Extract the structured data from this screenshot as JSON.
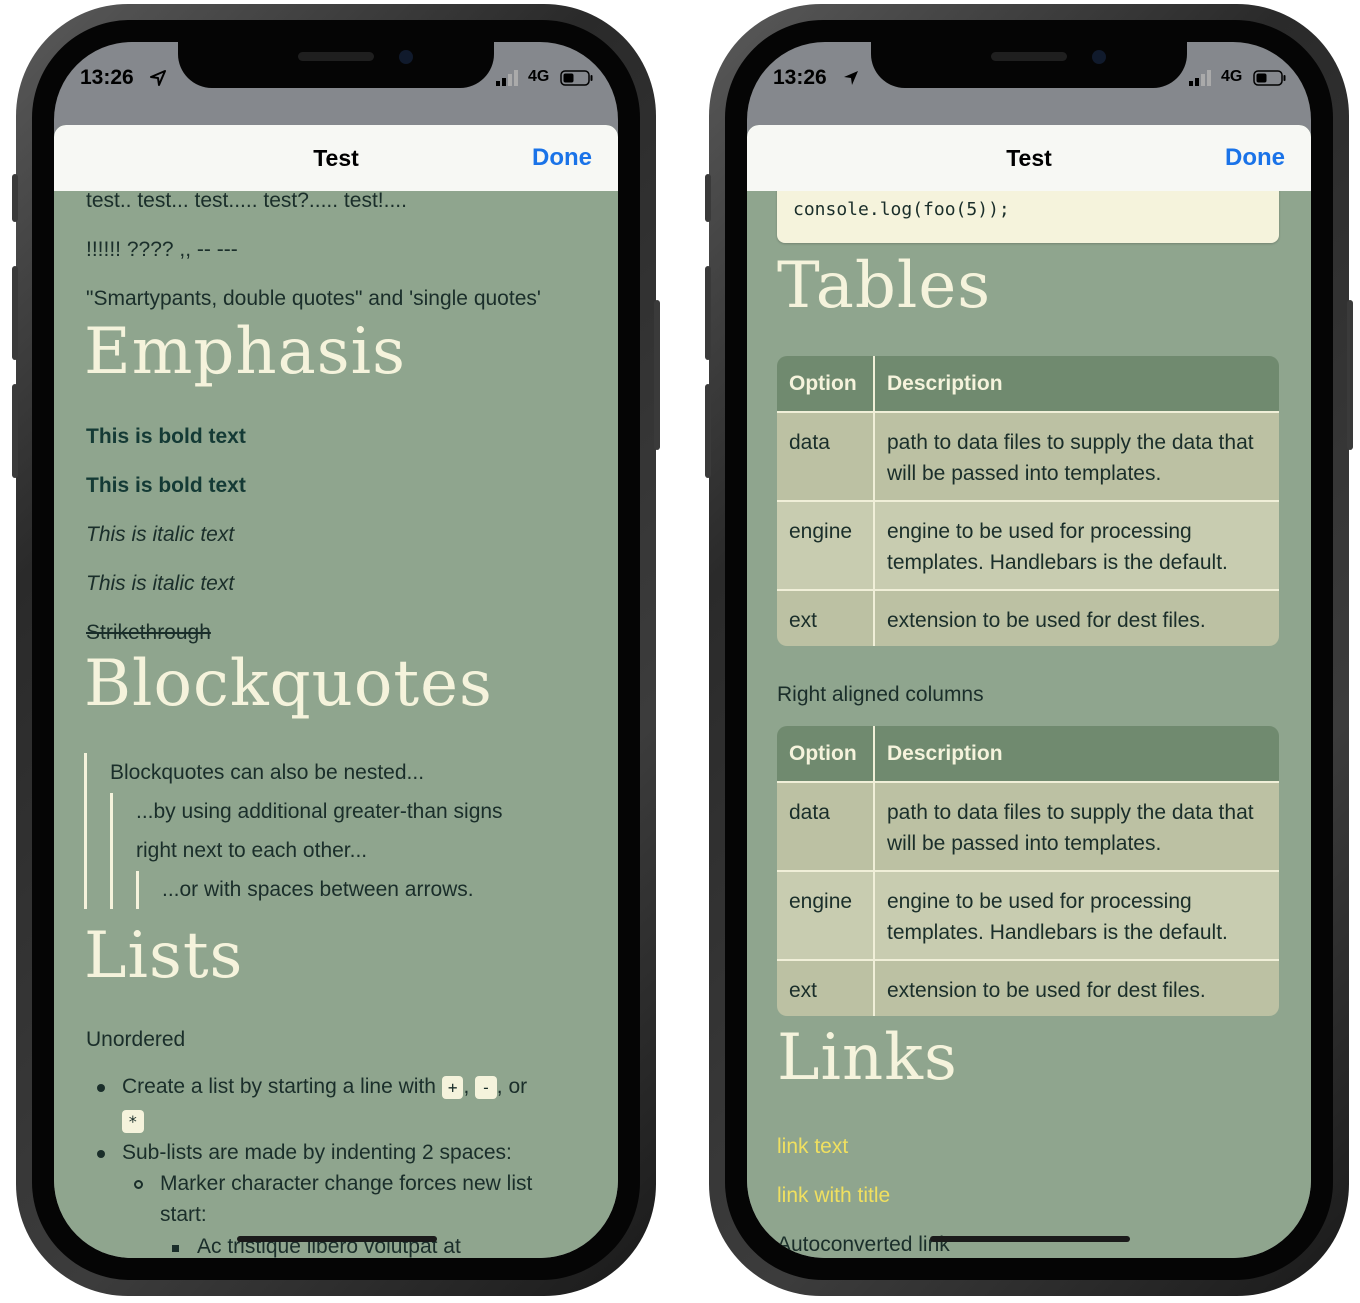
{
  "status": {
    "time": "13:26",
    "network": "4G"
  },
  "nav": {
    "title": "Test",
    "done": "Done"
  },
  "left": {
    "typo1": "test.. test... test..... test?..... test!....",
    "typo2": "!!!!!! ???? ,, -- ---",
    "typo3": "\"Smartypants, double quotes\" and 'single quotes'",
    "emphasis_heading": "Emphasis",
    "bold1": "This is bold text",
    "bold2": "This is bold text",
    "italic1": "This is italic text",
    "italic2": "This is italic text",
    "strike": "Strikethrough",
    "blockquotes_heading": "Blockquotes",
    "bq1": "Blockquotes can also be nested...",
    "bq2a": "...by using additional greater-than signs",
    "bq2b": "right next to each other...",
    "bq3": "...or with spaces between arrows.",
    "lists_heading": "Lists",
    "unordered": "Unordered",
    "li1_pre": "Create a list by starting a line with",
    "li1_plus": "+",
    "li1_comma": ",",
    "li1_minus": "-",
    "li1_or": ", or",
    "li1_star": "*",
    "li2": "Sub-lists are made by indenting 2 spaces:",
    "li2a_1": "Marker character change forces new list",
    "li2a_2": "start:",
    "li3": "Ac tristique libero volutpat at"
  },
  "right": {
    "code": "console.log(foo(5));",
    "tables_heading": "Tables",
    "table_headers": [
      "Option",
      "Description"
    ],
    "table_rows": [
      [
        "data",
        "path to data files to supply the data that will be passed into templates."
      ],
      [
        "engine",
        "engine to be used for processing templates. Handlebars is the default."
      ],
      [
        "ext",
        "extension to be used for dest files."
      ]
    ],
    "right_aligned": "Right aligned columns",
    "links_heading": "Links",
    "link1": "link text",
    "link2": "link with title",
    "autolink": "Autoconverted link"
  }
}
